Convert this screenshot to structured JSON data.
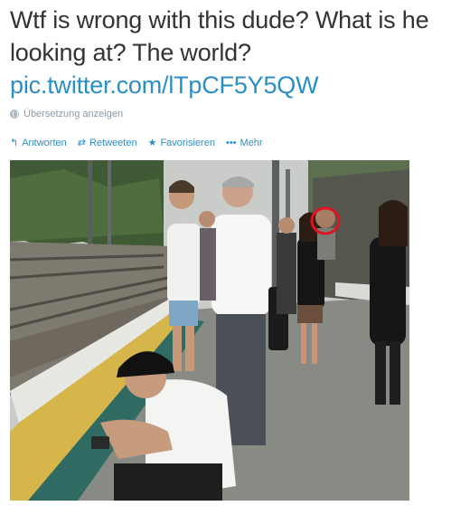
{
  "tweet": {
    "text": "Wtf is wrong with this dude? What is he looking at? The world?",
    "link": "pic.twitter.com/lTpCF5Y5QW"
  },
  "translate": {
    "label": "Übersetzung anzeigen",
    "icon": "globe-icon"
  },
  "actions": [
    {
      "label": "Antworten",
      "icon": "reply-icon"
    },
    {
      "label": "Retweeten",
      "icon": "retweet-icon"
    },
    {
      "label": "Favorisieren",
      "icon": "star-icon"
    },
    {
      "label": "Mehr",
      "icon": "more-icon"
    }
  ],
  "colors": {
    "link": "#2a8fc7",
    "text": "#333333",
    "muted": "#8899a6",
    "circle": "#e0141c"
  }
}
